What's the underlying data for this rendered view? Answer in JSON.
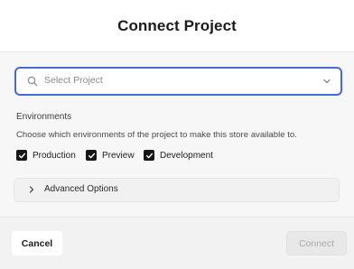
{
  "dialog": {
    "title": "Connect Project"
  },
  "project_select": {
    "placeholder": "Select Project",
    "icon": "search-icon",
    "dropdown_icon": "chevron-down-icon",
    "focus_color": "#4a67d6"
  },
  "environments": {
    "title": "Environments",
    "description": "Choose which environments of the project to make this store available to.",
    "options": [
      {
        "label": "Production",
        "checked": true
      },
      {
        "label": "Preview",
        "checked": true
      },
      {
        "label": "Development",
        "checked": true
      }
    ]
  },
  "advanced": {
    "label": "Advanced Options",
    "icon": "chevron-right-icon",
    "expanded": false
  },
  "footer": {
    "cancel_label": "Cancel",
    "connect_label": "Connect",
    "connect_enabled": false
  }
}
